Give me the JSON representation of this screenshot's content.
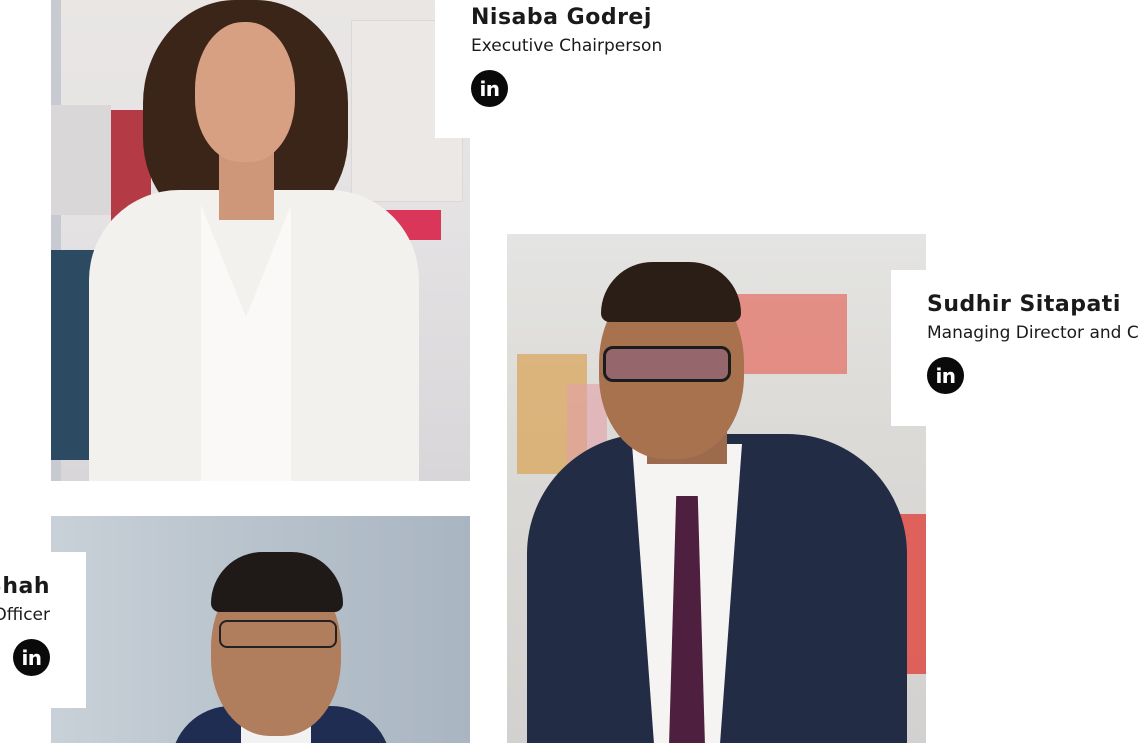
{
  "people": [
    {
      "name": "Nisaba Godrej",
      "role": "Executive Chairperson",
      "social": {
        "icon": "linkedin-icon",
        "label": "in"
      }
    },
    {
      "name": "Sudhir Sitapati",
      "role": "Managing Director and CE",
      "social": {
        "icon": "linkedin-icon",
        "label": "in"
      }
    },
    {
      "name": "Shah",
      "role": "Officer",
      "social": {
        "icon": "linkedin-icon",
        "label": "in"
      }
    }
  ],
  "colors": {
    "background": "#ffffff",
    "text": "#1a1a1a",
    "linkedin_badge": "#0a0a0a"
  }
}
